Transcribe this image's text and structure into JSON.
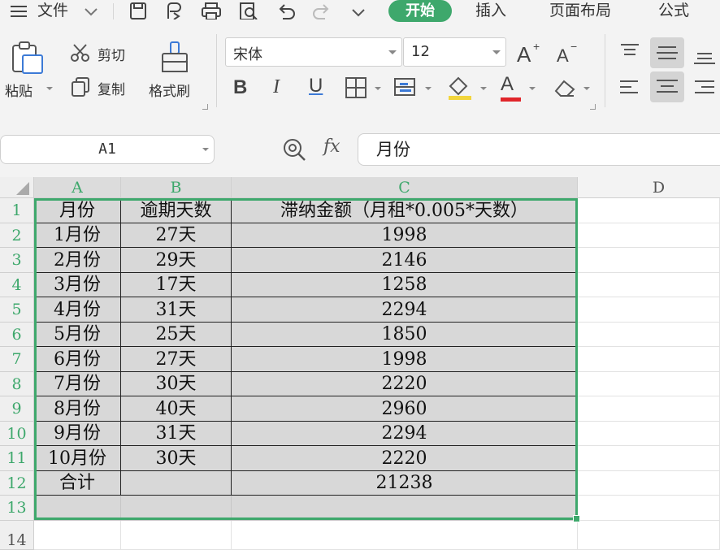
{
  "menu": {
    "file_label": "文件",
    "tabs": [
      "开始",
      "插入",
      "页面布局",
      "公式"
    ]
  },
  "ribbon": {
    "paste_label": "粘贴",
    "cut_label": "剪切",
    "copy_label": "复制",
    "format_painter_label": "格式刷",
    "font_name": "宋体",
    "font_size": "12",
    "bold_label": "B",
    "italic_label": "I",
    "underline_label": "U",
    "font_color_label": "A"
  },
  "formula_bar": {
    "cell_ref": "A1",
    "fx_label": "fx",
    "formula_value": "月份"
  },
  "columns": [
    "A",
    "B",
    "C",
    "D"
  ],
  "rows": [
    "1",
    "2",
    "3",
    "4",
    "5",
    "6",
    "7",
    "8",
    "9",
    "10",
    "11",
    "12",
    "13",
    "14"
  ],
  "table": {
    "header": [
      "月份",
      "逾期天数",
      "滞纳金额（月租*0.005*天数）"
    ],
    "data": [
      [
        "1月份",
        "27天",
        "1998"
      ],
      [
        "2月份",
        "29天",
        "2146"
      ],
      [
        "3月份",
        "17天",
        "1258"
      ],
      [
        "4月份",
        "31天",
        "2294"
      ],
      [
        "5月份",
        "25天",
        "1850"
      ],
      [
        "6月份",
        "27天",
        "1998"
      ],
      [
        "7月份",
        "30天",
        "2220"
      ],
      [
        "8月份",
        "40天",
        "2960"
      ],
      [
        "9月份",
        "31天",
        "2294"
      ],
      [
        "10月份",
        "30天",
        "2220"
      ]
    ],
    "total": [
      "合计",
      "",
      "21238"
    ]
  },
  "colors": {
    "accent": "#3ea86c",
    "selection_fill": "#d8d8d8"
  }
}
